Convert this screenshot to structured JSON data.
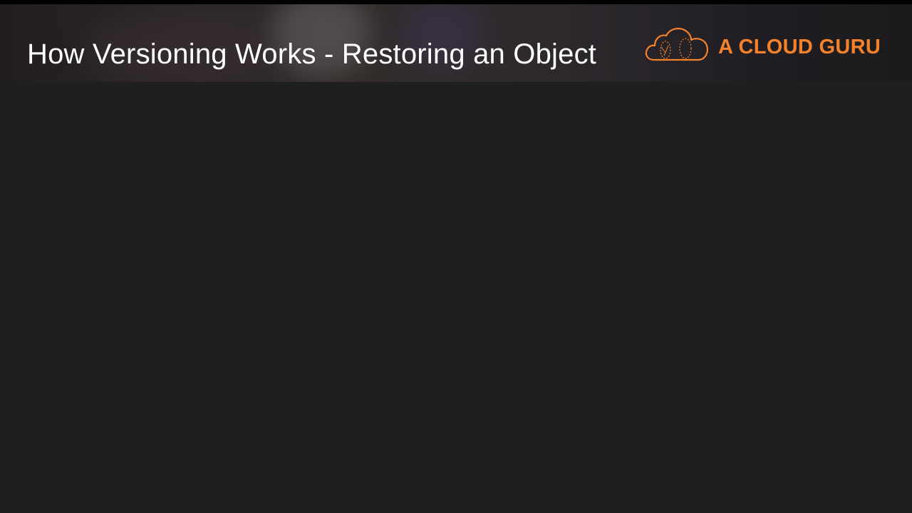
{
  "header": {
    "title": "How Versioning Works - Restoring an Object"
  },
  "logo": {
    "text": "A CLOUD GURU",
    "icon": "cloud-icon",
    "brand_color": "#f5822a"
  },
  "colors": {
    "background": "#1f1f1f",
    "title_text": "#ffffff"
  }
}
